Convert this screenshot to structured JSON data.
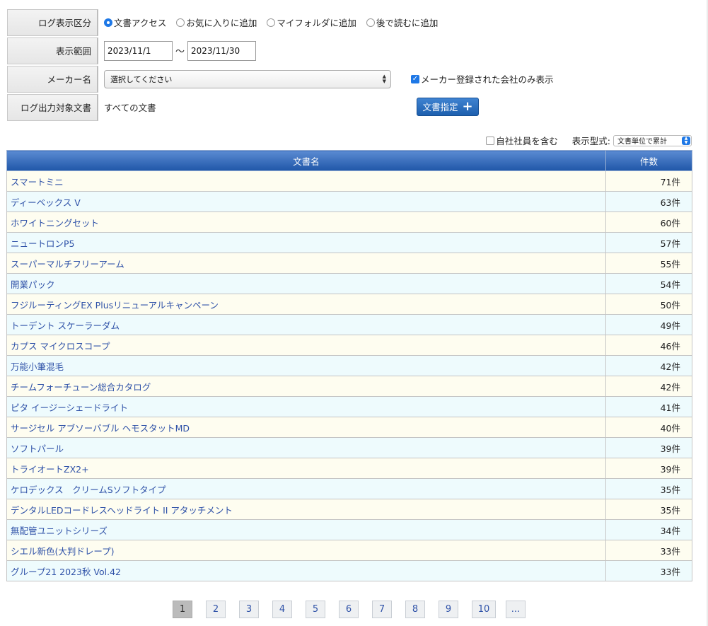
{
  "filters": {
    "log_type": {
      "label": "ログ表示区分",
      "options": [
        {
          "label": "文書アクセス",
          "checked": true
        },
        {
          "label": "お気に入りに追加",
          "checked": false
        },
        {
          "label": "マイフォルダに追加",
          "checked": false
        },
        {
          "label": "後で読むに追加",
          "checked": false
        }
      ]
    },
    "range": {
      "label": "表示範囲",
      "from": "2023/11/1",
      "separator": "〜",
      "to": "2023/11/30"
    },
    "maker": {
      "label": "メーカー名",
      "select_value": "選択してください",
      "registered_only_label": "メーカー登録された会社のみ表示",
      "registered_only_checked": true
    },
    "target_docs": {
      "label": "ログ出力対象文書",
      "value": "すべての文書",
      "button_label": "文書指定",
      "button_icon": "plus-icon"
    }
  },
  "options": {
    "include_employees_label": "自社社員を含む",
    "include_employees_checked": false,
    "display_type_label": "表示型式:",
    "display_type_value": "文書単位で累計"
  },
  "table": {
    "headers": [
      "文書名",
      "件数"
    ],
    "rows": [
      {
        "name": "スマートミニ",
        "count": "71件"
      },
      {
        "name": "ディーベックス V",
        "count": "63件"
      },
      {
        "name": "ホワイトニングセット",
        "count": "60件"
      },
      {
        "name": "ニュートロンP5",
        "count": "57件"
      },
      {
        "name": "スーパーマルチフリーアーム",
        "count": "55件"
      },
      {
        "name": "開業パック",
        "count": "54件"
      },
      {
        "name": "フジルーティングEX Plusリニューアルキャンペーン",
        "count": "50件"
      },
      {
        "name": "トーデント スケーラーダム",
        "count": "49件"
      },
      {
        "name": "カプス マイクロスコープ",
        "count": "46件"
      },
      {
        "name": "万能小筆混毛",
        "count": "42件"
      },
      {
        "name": "チームフォーチューン総合カタログ",
        "count": "42件"
      },
      {
        "name": "ピタ イージーシェードライト",
        "count": "41件"
      },
      {
        "name": "サージセル アブソーバブル ヘモスタットMD",
        "count": "40件"
      },
      {
        "name": "ソフトパール",
        "count": "39件"
      },
      {
        "name": "トライオートZX2+",
        "count": "39件"
      },
      {
        "name": "ケロデックス　クリームSソフトタイプ",
        "count": "35件"
      },
      {
        "name": "デンタルLEDコードレスヘッドライト II アタッチメント",
        "count": "35件"
      },
      {
        "name": "無配管ユニットシリーズ",
        "count": "34件"
      },
      {
        "name": "シエル新色(大判ドレープ)",
        "count": "33件"
      },
      {
        "name": "グループ21 2023秋 Vol.42",
        "count": "33件"
      }
    ]
  },
  "pagination": {
    "pages": [
      "1",
      "2",
      "3",
      "4",
      "5",
      "6",
      "7",
      "8",
      "9",
      "10",
      "..."
    ],
    "current": "1"
  }
}
